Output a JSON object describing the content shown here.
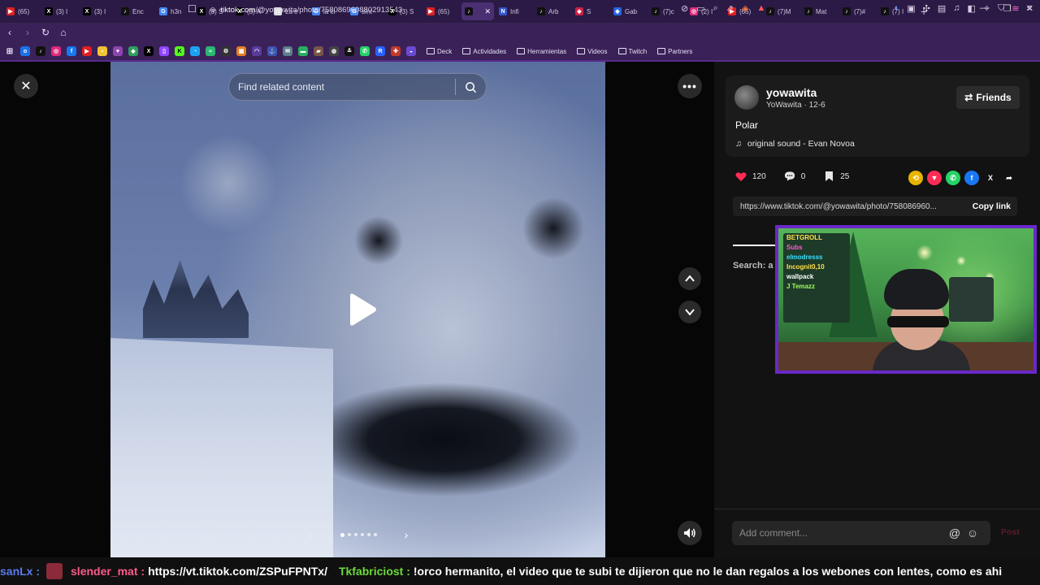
{
  "browser": {
    "tabs": [
      {
        "icon": "youtube-icon",
        "color": "#e02020",
        "label": "(65)"
      },
      {
        "icon": "x-icon",
        "color": "#000000",
        "label": "(3) I"
      },
      {
        "icon": "x-icon",
        "color": "#000000",
        "label": "(3) I"
      },
      {
        "icon": "tiktok-icon",
        "color": "#111111",
        "label": "Enc"
      },
      {
        "icon": "google-icon",
        "color": "#4285f4",
        "label": "h3n"
      },
      {
        "icon": "x-icon",
        "color": "#000000",
        "label": "(3) S"
      },
      {
        "icon": "x-icon",
        "color": "#000000",
        "label": "(3) A"
      },
      {
        "icon": "wikipedia-icon",
        "color": "#dddddd",
        "label": "La c"
      },
      {
        "icon": "google-icon",
        "color": "#4285f4",
        "label": "la cl"
      },
      {
        "icon": "google-icon",
        "color": "#4285f4",
        "label": "sínt"
      },
      {
        "icon": "x-icon",
        "color": "#000000",
        "label": "(3) S"
      },
      {
        "icon": "youtube-icon",
        "color": "#e02020",
        "label": "(65)"
      },
      {
        "icon": "tiktok-icon",
        "color": "#111111",
        "label": "",
        "active": true
      },
      {
        "icon": "notion-icon",
        "color": "#3355cc",
        "label": "Infi"
      },
      {
        "icon": "tiktok-icon",
        "color": "#111111",
        "label": "Arb"
      },
      {
        "icon": "app-icon",
        "color": "#cc2244",
        "label": "S"
      },
      {
        "icon": "app-icon",
        "color": "#2266dd",
        "label": "Gab"
      },
      {
        "icon": "tiktok-icon",
        "color": "#111111",
        "label": "(7)c"
      },
      {
        "icon": "instagram-icon",
        "color": "#dd2a7b",
        "label": "(2) I"
      },
      {
        "icon": "youtube-icon",
        "color": "#e02020",
        "label": "(65)"
      },
      {
        "icon": "tiktok-icon",
        "color": "#111111",
        "label": "(7)M"
      },
      {
        "icon": "tiktok-icon",
        "color": "#111111",
        "label": "Mat"
      },
      {
        "icon": "tiktok-icon",
        "color": "#111111",
        "label": "(7)#"
      },
      {
        "icon": "tiktok-icon",
        "color": "#111111",
        "label": "(7) I"
      }
    ],
    "new_tab": "+",
    "url_domain": "tiktok.com",
    "url_path": "/@yowawita/photo/7580869608802913543",
    "bookmark_folders": [
      "Deck",
      "Actividades",
      "Herramientas",
      "Videos",
      "Twitch",
      "Partners"
    ]
  },
  "viewer": {
    "search_placeholder": "Find related content",
    "page_count": 6,
    "active_page": 1
  },
  "post": {
    "username": "yowawita",
    "display_name": "YoWawita",
    "date": "12-6",
    "friends_label": "Friends",
    "caption": "Polar",
    "sound": "original sound - Evan Novoa",
    "likes": "120",
    "comments": "0",
    "saves": "25",
    "link": "https://www.tiktok.com/@yowawita/photo/758086960...",
    "copy_link_label": "Copy link",
    "search_hint": "Search: a",
    "comment_placeholder": "Add comment...",
    "post_label": "Post"
  },
  "share_icons": [
    {
      "icon": "repost-icon",
      "color": "#e8b400",
      "label": "⟲"
    },
    {
      "icon": "send-icon",
      "color": "#fe2c55",
      "label": "▼"
    },
    {
      "icon": "whatsapp-icon",
      "color": "#25d366",
      "label": "✆"
    },
    {
      "icon": "facebook-icon",
      "color": "#1877f2",
      "label": "f"
    },
    {
      "icon": "x-icon",
      "color": "#121212",
      "label": "X"
    },
    {
      "icon": "share-icon",
      "color": "#121212",
      "label": "➦"
    }
  ],
  "webcam": {
    "board_lines": [
      "BETGROLL",
      "Subs",
      "elmodresss",
      "Incognit0,10",
      "wallpack",
      "J Temazz"
    ]
  },
  "chat": [
    {
      "user": "sanLx",
      "color": "#5a7cf0",
      "message": "",
      "badge": true
    },
    {
      "user": "slender_mat",
      "color": "#ff5a8a",
      "message": "https://vt.tiktok.com/ZSPuFPNTx/"
    },
    {
      "user": "Tkfabriciost",
      "color": "#6bdc3a",
      "message": "!orco hermanito, el video que te subi te dijieron que no le dan regalos a los webones con lentes, como es ahi"
    }
  ]
}
